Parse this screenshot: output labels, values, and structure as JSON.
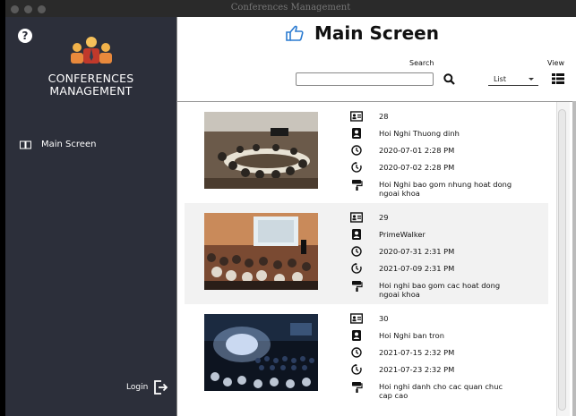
{
  "window": {
    "title": "Conferences Management"
  },
  "sidebar": {
    "help_label": "?",
    "app_name_line1": "CONFERENCES",
    "app_name_line2": "MANAGEMENT",
    "nav_items": [
      {
        "label": "Main Screen",
        "icon": "book-icon"
      }
    ],
    "login_label": "Login"
  },
  "header": {
    "title": "Main Screen",
    "search_label": "Search",
    "search_value": "",
    "view_label": "View",
    "view_selected": "List"
  },
  "conferences": [
    {
      "id": "28",
      "name": "Hoi Nghi Thuong dinh",
      "start": "2020-07-01 2:28 PM",
      "end": "2020-07-02 2:28 PM",
      "description": "Hoi Nghi bao gom nhung hoat dong ngoai khoa"
    },
    {
      "id": "29",
      "name": "PrimeWalker",
      "start": "2020-07-31 2:31 PM",
      "end": "2021-07-09 2:31 PM",
      "description": "Hoi nghi bao gom cac hoat dong ngoai khoa"
    },
    {
      "id": "30",
      "name": "Hoi Nghi ban tron",
      "start": "2021-07-15 2:32 PM",
      "end": "2021-07-23 2:32 PM",
      "description": "Hoi nghi danh cho cac quan chuc cap cao"
    }
  ]
}
